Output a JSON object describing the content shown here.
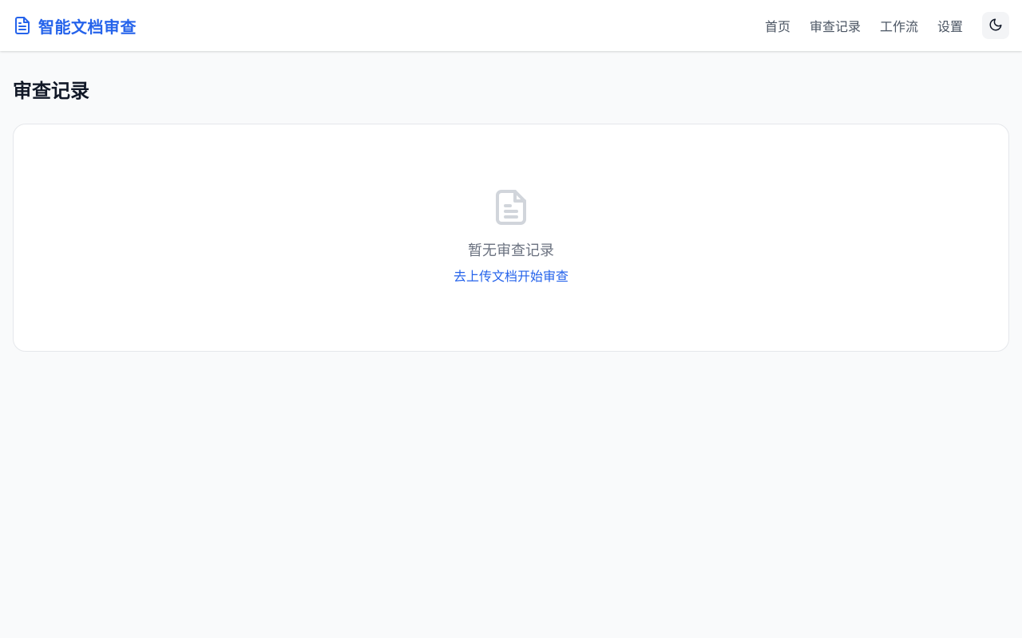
{
  "header": {
    "brand_title": "智能文档审查",
    "brand_icon": "document-icon",
    "nav": [
      {
        "label": "首页"
      },
      {
        "label": "审查记录"
      },
      {
        "label": "工作流"
      },
      {
        "label": "设置"
      }
    ],
    "theme_toggle_icon": "moon-icon"
  },
  "main": {
    "page_title": "审查记录",
    "empty_state": {
      "icon": "document-icon",
      "message": "暂无审查记录",
      "link_label": "去上传文档开始审查"
    }
  },
  "colors": {
    "accent": "#2563eb",
    "background": "#f9fafb",
    "card": "#ffffff",
    "muted_text": "#6b7280",
    "icon_gray": "#d1d5db"
  }
}
